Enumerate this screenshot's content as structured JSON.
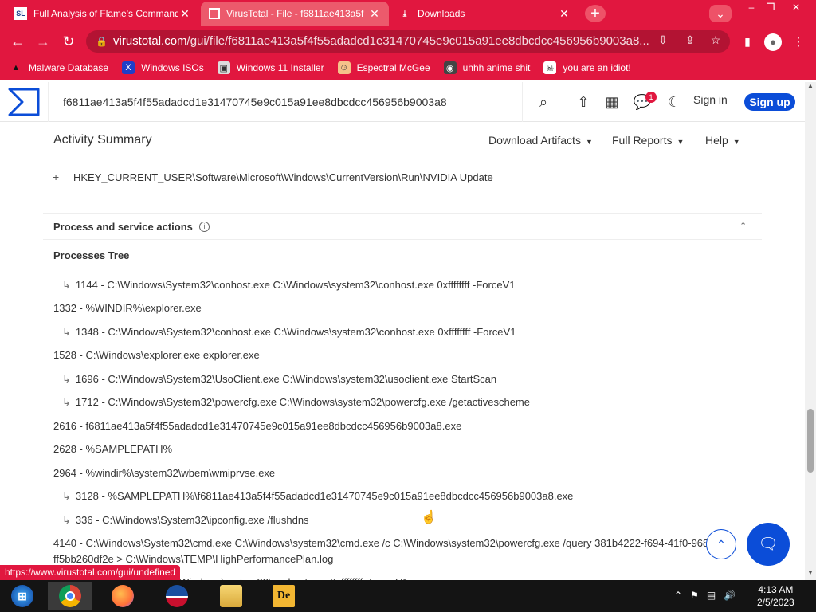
{
  "browser": {
    "tabs": [
      {
        "label": "Full Analysis of Flame's Command",
        "favicon": "SL"
      },
      {
        "label": "VirusTotal - File - f6811ae413a5f"
      },
      {
        "label": "Downloads"
      }
    ],
    "url_host": "virustotal.com",
    "url_path": "/gui/file/f6811ae413a5f4f55adadcd1e31470745e9c015a91ee8dbcdcc456956b9003a8...",
    "bookmarks": [
      {
        "label": "Malware Database"
      },
      {
        "label": "Windows ISOs"
      },
      {
        "label": "Windows 11 Installer"
      },
      {
        "label": "Espectral McGee"
      },
      {
        "label": "uhhh anime shit"
      },
      {
        "label": "you are an idiot!"
      }
    ],
    "status_url": "https://www.virustotal.com/gui/undefined"
  },
  "vt": {
    "search_value": "f6811ae413a5f4f55adadcd1e31470745e9c015a91ee8dbcdcc456956b9003a8",
    "notification_count": "1",
    "signin": "Sign in",
    "signup": "Sign up",
    "activity_title": "Activity Summary",
    "menus": [
      "Download Artifacts",
      "Full Reports",
      "Help"
    ],
    "registry_key": "HKEY_CURRENT_USER\\Software\\Microsoft\\Windows\\CurrentVersion\\Run\\NVIDIA Update",
    "section_title": "Process and service actions",
    "tree_title": "Processes Tree",
    "processes": [
      {
        "child": true,
        "text": "1144 - C:\\Windows\\System32\\conhost.exe C:\\Windows\\system32\\conhost.exe 0xffffffff -ForceV1"
      },
      {
        "child": false,
        "text": "1332 - %WINDIR%\\explorer.exe"
      },
      {
        "child": true,
        "text": "1348 - C:\\Windows\\System32\\conhost.exe C:\\Windows\\system32\\conhost.exe 0xffffffff -ForceV1"
      },
      {
        "child": false,
        "text": "1528 - C:\\Windows\\explorer.exe explorer.exe"
      },
      {
        "child": true,
        "text": "1696 - C:\\Windows\\System32\\UsoClient.exe C:\\Windows\\system32\\usoclient.exe StartScan"
      },
      {
        "child": true,
        "text": "1712 - C:\\Windows\\System32\\powercfg.exe C:\\Windows\\system32\\powercfg.exe /getactivescheme"
      },
      {
        "child": false,
        "text": "2616 - f6811ae413a5f4f55adadcd1e31470745e9c015a91ee8dbcdcc456956b9003a8.exe"
      },
      {
        "child": false,
        "text": "2628 - %SAMPLEPATH%"
      },
      {
        "child": false,
        "text": "2964 - %windir%\\system32\\wbem\\wmiprvse.exe"
      },
      {
        "child": true,
        "text": "3128 - %SAMPLEPATH%\\f6811ae413a5f4f55adadcd1e31470745e9c015a91ee8dbcdcc456956b9003a8.exe"
      },
      {
        "child": true,
        "text": "336 - C:\\Windows\\System32\\ipconfig.exe /flushdns"
      },
      {
        "child": false,
        "text": "4140 - C:\\Windows\\System32\\cmd.exe C:\\Windows\\system32\\cmd.exe /c C:\\Windows\\system32\\powercfg.exe /query 381b4222-f694-41f0-968"
      },
      {
        "child": false,
        "text": "ff5bb260df2e > C:\\Windows\\TEMP\\HighPerformancePlan.log",
        "continuation": true
      },
      {
        "child": true,
        "text": "tem32\\conhost.exe C:\\Windows\\system32\\conhost.exe 0xffffffff -ForceV1"
      }
    ]
  },
  "taskbar": {
    "time": "4:13 AM",
    "date": "2/5/2023",
    "apps": [
      "start",
      "chrome",
      "firefox",
      "obama",
      "file-explorer",
      "de"
    ]
  },
  "colors": {
    "chrome_theme": "#e1173f",
    "vt_blue": "#0b4dd8"
  }
}
